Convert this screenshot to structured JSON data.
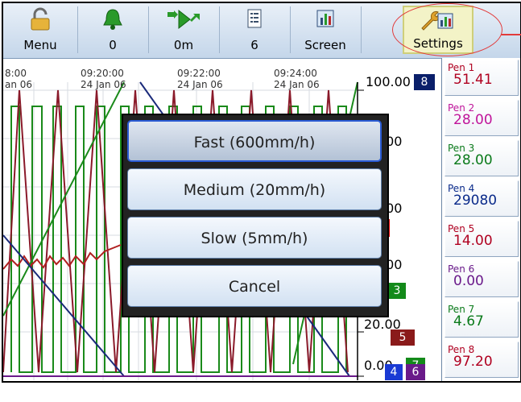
{
  "toolbar": {
    "menu_label": "Menu",
    "alarms_label": "0",
    "speed_label": "0m",
    "pens_label": "6",
    "screen_label": "Screen",
    "settings_label": "Settings"
  },
  "chart": {
    "time_ticks": [
      {
        "time": "8:00",
        "date": "an 06"
      },
      {
        "time": "09:20:00",
        "date": "24 Jan 06"
      },
      {
        "time": "09:22:00",
        "date": "24 Jan 06"
      },
      {
        "time": "09:24:00",
        "date": "24 Jan 06"
      }
    ],
    "scale_labels": [
      "100.00",
      ".00",
      ".00",
      ".00",
      "20.00",
      "0.00"
    ],
    "pen_tags": [
      "8",
      "3",
      "5",
      "7",
      "4",
      "6"
    ]
  },
  "pens": [
    {
      "name": "Pen 1",
      "value": "51.41",
      "color": "#b00020"
    },
    {
      "name": "Pen 2",
      "value": "28.00",
      "color": "#c0149a"
    },
    {
      "name": "Pen 3",
      "value": "28.00",
      "color": "#0a7a1a"
    },
    {
      "name": "Pen 4",
      "value": "29080",
      "color": "#0a2a8a"
    },
    {
      "name": "Pen 5",
      "value": "14.00",
      "color": "#b00020"
    },
    {
      "name": "Pen 6",
      "value": "0.00",
      "color": "#6a1a8a"
    },
    {
      "name": "Pen 7",
      "value": "4.67",
      "color": "#0a7a1a"
    },
    {
      "name": "Pen 8",
      "value": "97.20",
      "color": "#b00020"
    }
  ],
  "dialog": {
    "options": [
      "Fast (600mm/h)",
      "Medium (20mm/h)",
      "Slow (5mm/h)",
      "Cancel"
    ],
    "selected": 0
  }
}
